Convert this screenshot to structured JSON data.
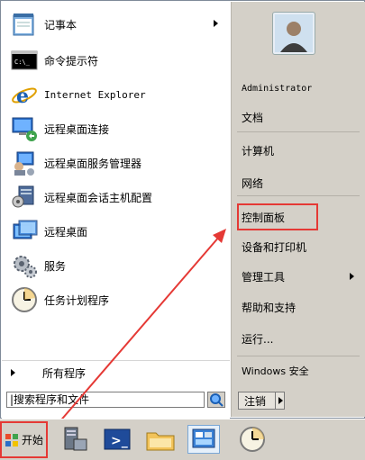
{
  "left_menu": {
    "items": [
      {
        "label": "记事本",
        "icon": "notepad-icon",
        "has_submenu": true
      },
      {
        "label": "命令提示符",
        "icon": "cmd-icon"
      },
      {
        "label": "Internet Explorer",
        "icon": "ie-icon"
      },
      {
        "label": "远程桌面连接",
        "icon": "remote-desktop-connection-icon"
      },
      {
        "label": "远程桌面服务管理器",
        "icon": "rds-manager-icon"
      },
      {
        "label": "远程桌面会话主机配置",
        "icon": "rd-session-host-config-icon"
      },
      {
        "label": "远程桌面",
        "icon": "remote-desktops-icon"
      },
      {
        "label": "服务",
        "icon": "services-icon"
      },
      {
        "label": "任务计划程序",
        "icon": "task-scheduler-icon"
      }
    ],
    "all_programs": "所有程序"
  },
  "search": {
    "value": "|搜索程序和文件"
  },
  "right_menu": {
    "user": "Administrator",
    "items": [
      {
        "label": "文档"
      },
      {
        "label": "计算机"
      },
      {
        "label": "网络"
      },
      {
        "label": "控制面板",
        "highlighted": true
      },
      {
        "label": "设备和打印机"
      },
      {
        "label": "管理工具",
        "has_submenu": true
      },
      {
        "label": "帮助和支持"
      },
      {
        "label": "运行..."
      },
      {
        "label": "Windows 安全"
      }
    ],
    "logout": "注销"
  },
  "taskbar": {
    "start": "开始",
    "icons": [
      "server-manager-icon",
      "powershell-icon",
      "explorer-icon",
      "control-panel-icon",
      "clock-icon"
    ]
  },
  "colors": {
    "highlight": "#e53935",
    "accent": "#1a5fb4"
  }
}
